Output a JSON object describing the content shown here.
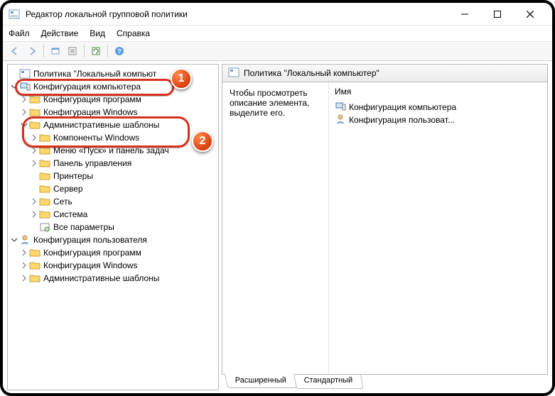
{
  "window": {
    "title": "Редактор локальной групповой политики"
  },
  "menu": {
    "file": "Файл",
    "action": "Действие",
    "view": "Вид",
    "help": "Справка"
  },
  "tree": {
    "root": "Политика \"Локальный компьют",
    "computer_config": "Конфигурация компьютера",
    "prog_config": "Конфигурация программ",
    "windows_config": "Конфигурация Windows",
    "admin_templates": "Административные шаблоны",
    "win_components": "Компоненты Windows",
    "start_taskbar": "Меню «Пуск» и панель задач",
    "control_panel": "Панель управления",
    "printers": "Принтеры",
    "server": "Сервер",
    "network": "Сеть",
    "system": "Система",
    "all_params": "Все параметры",
    "user_config": "Конфигурация пользователя",
    "u_prog_config": "Конфигурация программ",
    "u_windows_config": "Конфигурация Windows",
    "u_admin_templates": "Административные шаблоны"
  },
  "detail": {
    "header": "Политика \"Локальный компьютер\"",
    "description": "Чтобы просмотреть описание элемента, выделите его.",
    "col_name": "Имя",
    "item_computer": "Конфигурация компьютера",
    "item_user": "Конфигурация пользоват..."
  },
  "tabs": {
    "extended": "Расширенный",
    "standard": "Стандартный"
  },
  "annotations": {
    "badge1": "1",
    "badge2": "2"
  }
}
